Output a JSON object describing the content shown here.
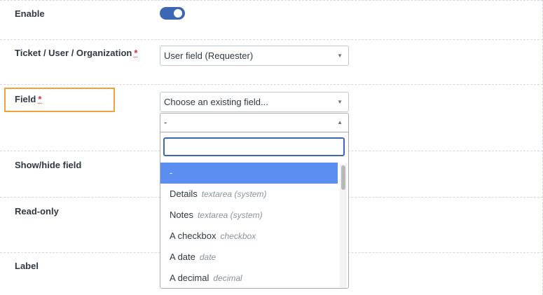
{
  "form": {
    "enable_label": "Enable",
    "entity_label": "Ticket / User / Organization",
    "entity_required": "*",
    "entity_value": "User field (Requester)",
    "field_label": "Field",
    "field_required": "*",
    "field_value": "Choose an existing field...",
    "show_hide_label": "Show/hide field",
    "read_only_label": "Read-only",
    "label_label": "Label",
    "enable_on": true
  },
  "dropdown": {
    "current_value": "-",
    "search_value": "",
    "options": [
      {
        "name": "-",
        "type": "",
        "selected": true
      },
      {
        "name": "Details",
        "type": "textarea (system)"
      },
      {
        "name": "Notes",
        "type": "textarea (system)"
      },
      {
        "name": "A checkbox",
        "type": "checkbox"
      },
      {
        "name": "A date",
        "type": "date"
      },
      {
        "name": "A decimal",
        "type": "decimal"
      }
    ]
  },
  "icons": {
    "caret_down": "caret-down-icon",
    "caret_up": "caret-up-icon"
  },
  "colors": {
    "toggle_on": "#3b67b4",
    "highlight_border": "#f0a33a",
    "selected_option": "#5b8ef0",
    "required_star": "#cc3340"
  }
}
